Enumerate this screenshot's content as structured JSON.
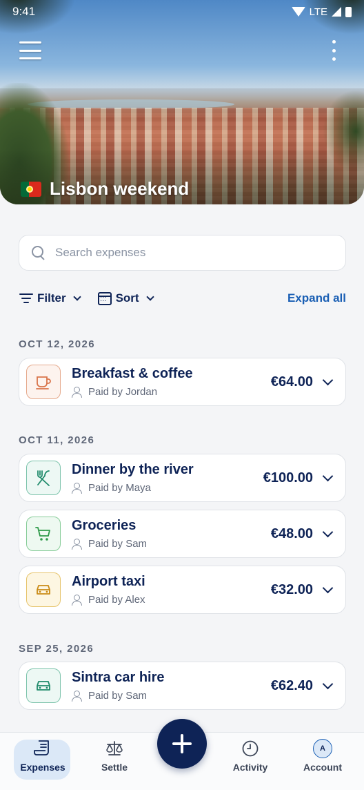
{
  "status_bar": {
    "time": "9:41",
    "network": "LTE"
  },
  "header": {
    "trip_name": "Lisbon weekend",
    "flag_icon": "portugal-flag-icon"
  },
  "search": {
    "placeholder": "Search expenses"
  },
  "controls": {
    "filter_label": "Filter",
    "sort_label": "Sort",
    "expand_all_label": "Expand all"
  },
  "groups": [
    {
      "date": "OCT 12, 2026"
    },
    {
      "date": "OCT 11, 2026"
    },
    {
      "date": "SEP 25, 2026"
    }
  ],
  "expenses": [
    {
      "title": "Breakfast & coffee",
      "paid_by": "Paid by Jordan",
      "amount": "€64.00",
      "icon": "coffee-cup-icon",
      "color": "#d9744a"
    },
    {
      "title": "Dinner by the river",
      "paid_by": "Paid by Maya",
      "amount": "€100.00",
      "icon": "fork-knife-icon",
      "color": "#1e8a6a"
    },
    {
      "title": "Groceries",
      "paid_by": "Paid by Sam",
      "amount": "€48.00",
      "icon": "shopping-cart-icon",
      "color": "#2f9a4a"
    },
    {
      "title": "Airport taxi",
      "paid_by": "Paid by Alex",
      "amount": "€32.00",
      "icon": "car-icon",
      "color": "#c98a14"
    },
    {
      "title": "Sintra car hire",
      "paid_by": "Paid by Sam",
      "amount": "€62.40",
      "icon": "car-icon",
      "color": "#1e8a6a"
    }
  ],
  "bottom_nav": {
    "expenses": "Expenses",
    "settle": "Settle",
    "activity": "Activity",
    "account": "Account",
    "account_initial": "A"
  },
  "colors": {
    "primary": "#0e2356",
    "link": "#1a5fb4",
    "active_nav": "#dbe8f7"
  }
}
